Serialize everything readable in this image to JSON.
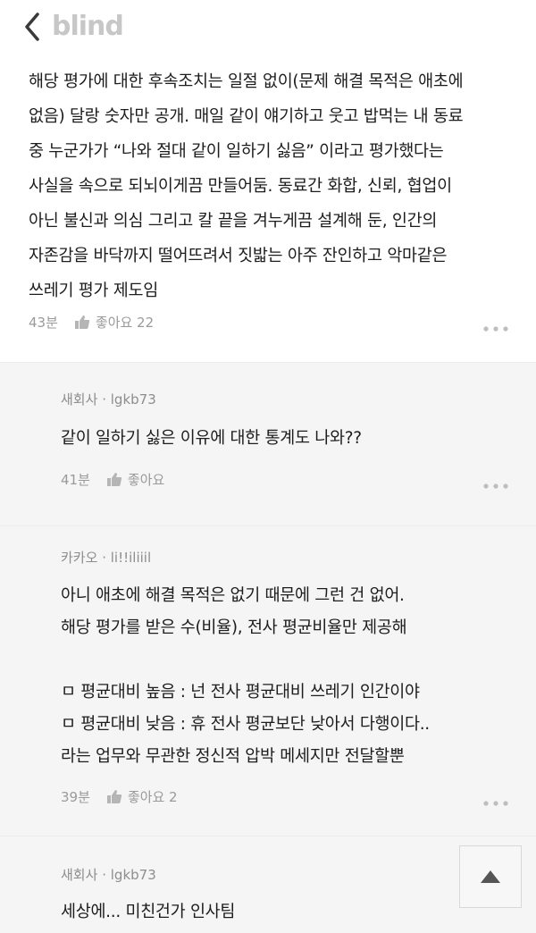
{
  "header": {
    "brand": "blind",
    "back_icon": "chevron-left-icon"
  },
  "main_comment": {
    "lines": [
      "해당 평가에 대한 후속조치는 일절 없이(문제 해결 목적은 애초에",
      "없음) 달랑 숫자만 공개. 매일 같이 얘기하고 웃고 밥먹는 내 동료",
      "중 누군가가 “나와 절대 같이 일하기 싫음” 이라고 평가했다는",
      "사실을 속으로 되뇌이게끔 만들어둠. 동료간 화합, 신뢰, 협업이",
      "아닌 불신과 의심 그리고 칼 끝을 겨누게끔 설계해 둔, 인간의",
      "자존감을 바닥까지 떨어뜨려서 짓밟는 아주 잔인하고 악마같은",
      "쓰레기 평가 제도임"
    ],
    "time": "43분",
    "like_label": "좋아요 22"
  },
  "replies": [
    {
      "company": "새회사",
      "separator": "·",
      "user": "lgkb73",
      "lines": [
        "같이 일하기 싫은 이유에 대한 통계도 나와??"
      ],
      "time": "41분",
      "like_label": "좋아요"
    },
    {
      "company": "카카오",
      "separator": "·",
      "user": "li!!iliiil",
      "lines": [
        "아니 애초에 해결 목적은 없기 때문에 그런 건 없어.",
        "해당 평가를 받은 수(비율), 전사 평균비율만 제공해",
        "",
        "ㅁ 평균대비 높음 : 넌 전사 평균대비 쓰레기 인간이야",
        "ㅁ 평균대비 낮음 : 휴 전사 평균보단 낮아서 다행이다..",
        "라는 업무와 무관한 정신적 압박 메세지만 전달할뿐"
      ],
      "time": "39분",
      "like_label": "좋아요 2"
    },
    {
      "company": "새회사",
      "separator": "·",
      "user": "lgkb73",
      "lines": [
        "세상에... 미친건가 인사팀"
      ]
    }
  ],
  "icons": {
    "like": "thumbs-up-icon",
    "more": "more-dots-icon",
    "scroll_top": "triangle-up-icon"
  },
  "colors": {
    "reply_bg": "#f5f5f5",
    "meta_text": "#9a9a9a",
    "brand_text": "#c7c7c7"
  }
}
